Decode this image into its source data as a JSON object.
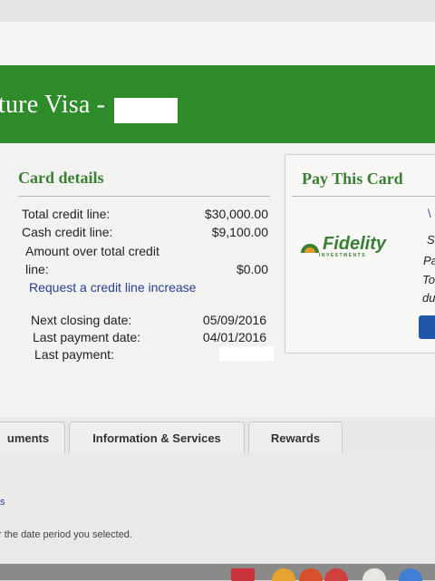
{
  "header": {
    "title": "ture Visa -"
  },
  "card_details": {
    "title": "Card details",
    "total_credit_line_label": "Total credit line:",
    "total_credit_line_value": "$30,000.00",
    "cash_credit_line_label": "Cash credit line:",
    "cash_credit_line_value": "$9,100.00",
    "amount_over_label_1": "Amount over total credit",
    "amount_over_label_2": "line:",
    "amount_over_value": "$0.00",
    "request_link": "Request a credit line increase",
    "next_closing_label": "Next closing date:",
    "next_closing_value": "05/09/2016",
    "last_payment_date_label": "Last payment date:",
    "last_payment_date_value": "04/01/2016",
    "last_payment_label": "Last payment:"
  },
  "pay_card": {
    "title": "Pay This Card",
    "logo_text": "Fidelity",
    "logo_sub": "INVESTMENTS",
    "side_fragments": [
      "S",
      "Pa",
      "To",
      "du"
    ]
  },
  "tabs": [
    {
      "label": "uments"
    },
    {
      "label": "Information & Services"
    },
    {
      "label": "Rewards"
    }
  ],
  "lower": {
    "footer_note": "r the date period you selected."
  },
  "colors": {
    "brand_green": "#2e8b2a",
    "link_blue": "#2a3f93",
    "button_blue": "#1f56a8"
  }
}
